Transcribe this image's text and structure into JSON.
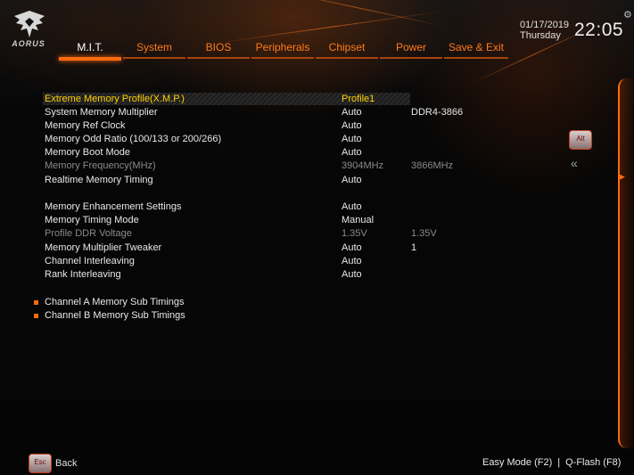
{
  "brand": {
    "logo_text": "AORUS"
  },
  "tabs": [
    {
      "label": "M.I.T.",
      "active": true
    },
    {
      "label": "System",
      "active": false
    },
    {
      "label": "BIOS",
      "active": false
    },
    {
      "label": "Peripherals",
      "active": false
    },
    {
      "label": "Chipset",
      "active": false
    },
    {
      "label": "Power",
      "active": false
    },
    {
      "label": "Save & Exit",
      "active": false
    }
  ],
  "clock": {
    "date": "01/17/2019",
    "day": "Thursday",
    "time": "22:05"
  },
  "settings": [
    {
      "label": "Extreme Memory Profile(X.M.P.)",
      "value": "Profile1",
      "value2": "",
      "state": "selected"
    },
    {
      "label": "System Memory Multiplier",
      "value": "Auto",
      "value2": "DDR4-3866",
      "state": "normal"
    },
    {
      "label": "Memory Ref Clock",
      "value": "Auto",
      "value2": "",
      "state": "normal"
    },
    {
      "label": "Memory Odd Ratio (100/133 or 200/266)",
      "value": "Auto",
      "value2": "",
      "state": "normal"
    },
    {
      "label": "Memory Boot Mode",
      "value": "Auto",
      "value2": "",
      "state": "normal"
    },
    {
      "label": "Memory Frequency(MHz)",
      "value": "3904MHz",
      "value2": "3866MHz",
      "state": "disabled"
    },
    {
      "label": "Realtime Memory Timing",
      "value": "Auto",
      "value2": "",
      "state": "normal"
    },
    {
      "label": "Memory Enhancement Settings",
      "value": "Auto",
      "value2": "",
      "state": "normal"
    },
    {
      "label": "Memory Timing Mode",
      "value": "Manual",
      "value2": "",
      "state": "normal"
    },
    {
      "label": "Profile DDR Voltage",
      "value": "1.35V",
      "value2": "1.35V",
      "state": "disabled"
    },
    {
      "label": "Memory Multiplier Tweaker",
      "value": "Auto",
      "value2": "1",
      "state": "normal"
    },
    {
      "label": "Channel Interleaving",
      "value": "Auto",
      "value2": "",
      "state": "normal"
    },
    {
      "label": "Rank Interleaving",
      "value": "Auto",
      "value2": "",
      "state": "normal"
    }
  ],
  "submenus": [
    {
      "label": "Channel A Memory Sub Timings"
    },
    {
      "label": "Channel B Memory Sub Timings"
    }
  ],
  "side": {
    "alt_key": "Alt",
    "collapse_glyph": "«"
  },
  "footer": {
    "esc_key": "Esc",
    "back_label": "Back",
    "easy_mode": "Easy Mode (F2)",
    "separator": "|",
    "qflash": "Q-Flash (F8)"
  },
  "colors": {
    "accent": "#ff6a10",
    "selected_text": "#ffd000",
    "disabled_text": "#8a8a8a"
  }
}
